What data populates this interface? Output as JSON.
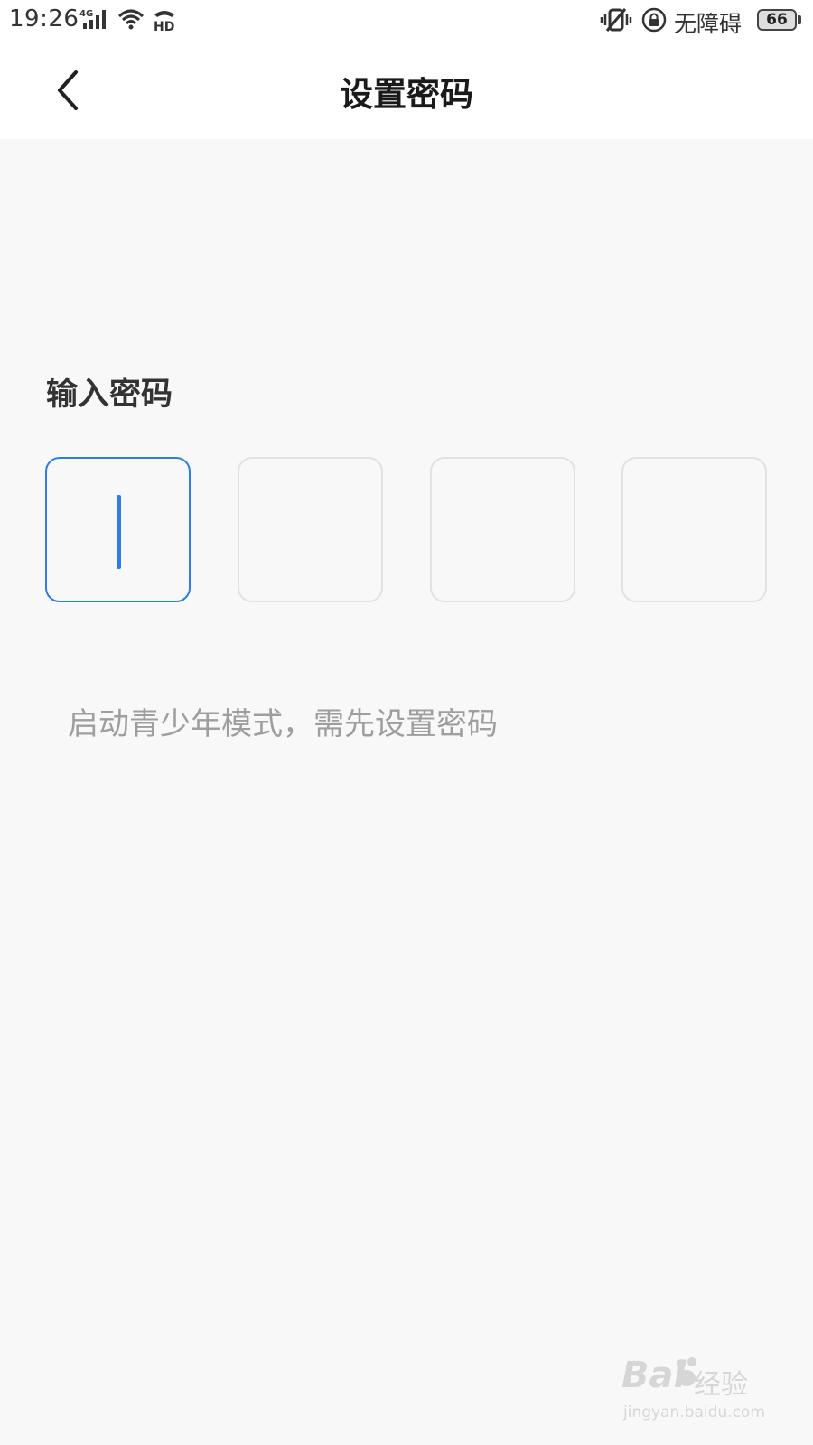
{
  "status_bar": {
    "time": "19:26",
    "network": "4G",
    "hd": "HD",
    "accessibility": "无障碍",
    "battery": "66"
  },
  "header": {
    "title": "设置密码",
    "back_icon": "chevron-left-icon"
  },
  "password": {
    "label": "输入密码",
    "digits": 4,
    "filled": 0,
    "active_index": 0,
    "active_color": "#2d7de8",
    "hint": "启动青少年模式，需先设置密码"
  },
  "watermark": {
    "logo": "Bai",
    "sub": "经验",
    "url": "jingyan.baidu.com"
  }
}
